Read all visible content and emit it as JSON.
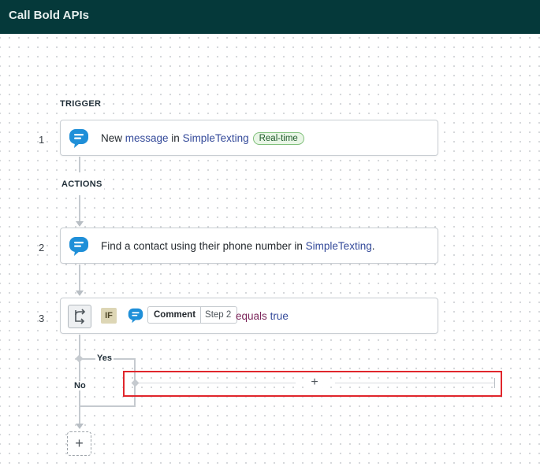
{
  "header": {
    "title": "Call Bold APIs"
  },
  "sections": {
    "trigger": "TRIGGER",
    "actions": "ACTIONS"
  },
  "steps": [
    {
      "number": "1",
      "prefix": "New ",
      "object": "message",
      "mid": " in ",
      "app": "SimpleTexting",
      "badge": "Real-time"
    },
    {
      "number": "2",
      "prefix": "Find a contact using their phone number in ",
      "app": "SimpleTexting",
      "suffix": "."
    },
    {
      "number": "3",
      "if_label": "IF",
      "field": "Comment",
      "field_step": "Step 2",
      "operator": "equals",
      "value": "true"
    }
  ],
  "branches": {
    "yes": "Yes",
    "no": "No"
  },
  "add_labels": {
    "branch_add": "+",
    "step_add": "+"
  },
  "colors": {
    "header_bg": "#05393a",
    "app_icon": "#1f8fd8",
    "highlight": "#e0262c",
    "badge_border": "#7fbf7a"
  },
  "icons": {
    "app": "simpletexting-chat-icon",
    "branch": "branch-path-icon"
  }
}
